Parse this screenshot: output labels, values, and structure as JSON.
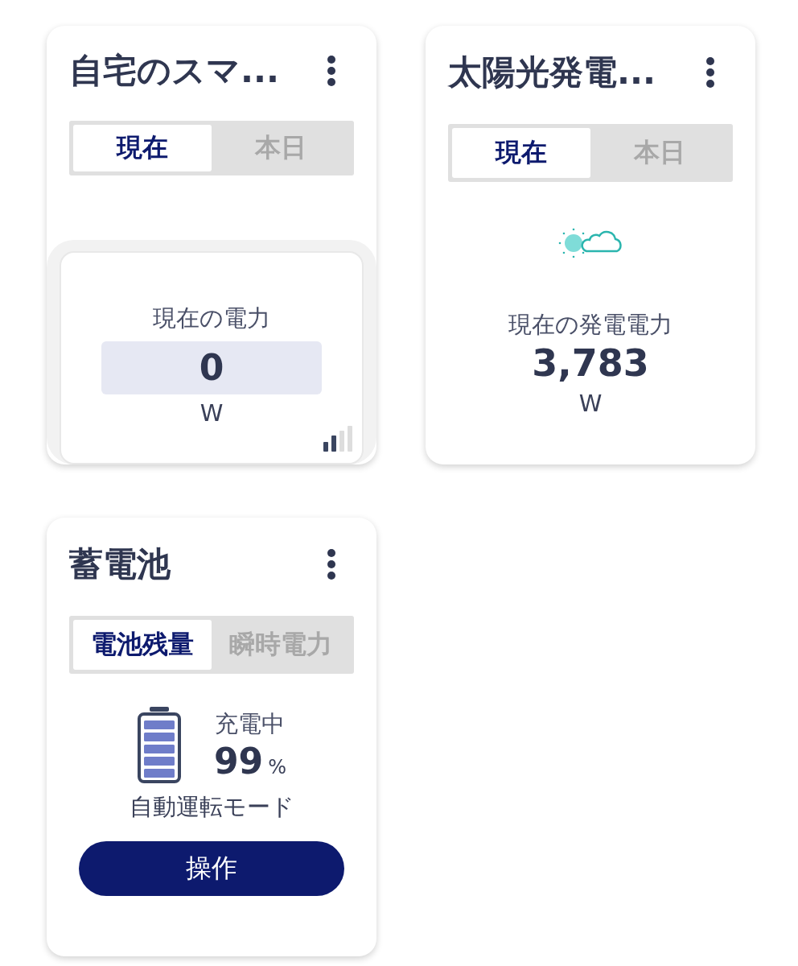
{
  "cards": [
    {
      "kind": "power",
      "title": "自宅のスマ...",
      "tabs": [
        {
          "label": "現在",
          "selected": true
        },
        {
          "label": "本日",
          "selected": false
        }
      ],
      "label": "現在の電力",
      "value": "0",
      "unit": "W"
    },
    {
      "kind": "solar",
      "title": "太陽光発電...",
      "tabs": [
        {
          "label": "現在",
          "selected": true
        },
        {
          "label": "本日",
          "selected": false
        }
      ],
      "label": "現在の発電電力",
      "value": "3,783",
      "unit": "W"
    },
    {
      "kind": "battery",
      "title": "蓄電池",
      "tabs": [
        {
          "label": "電池残量",
          "selected": true
        },
        {
          "label": "瞬時電力",
          "selected": false
        }
      ],
      "status": "充電中",
      "value": "99",
      "unit": "%",
      "mode": "自動運転モード",
      "button": "操作"
    }
  ]
}
